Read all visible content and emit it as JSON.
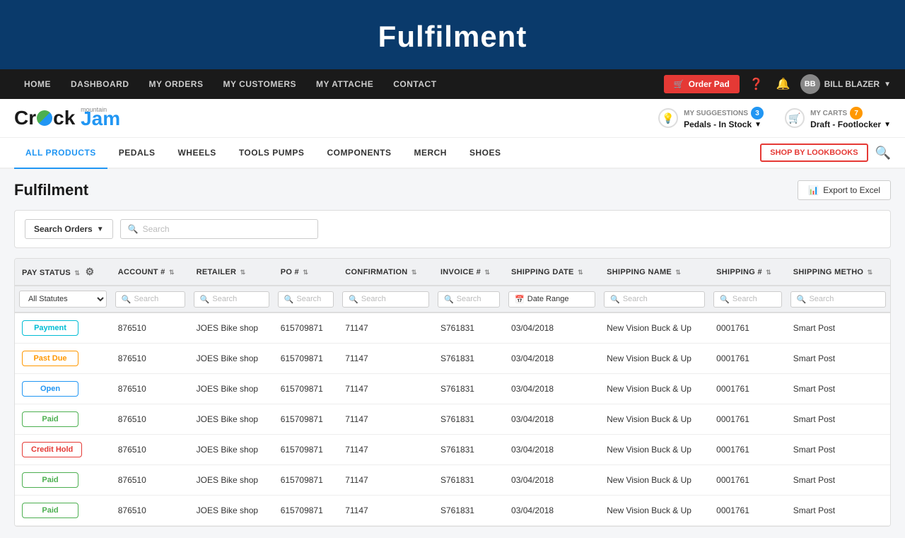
{
  "hero": {
    "title": "Fulfilment"
  },
  "topNav": {
    "items": [
      {
        "label": "HOME",
        "id": "home"
      },
      {
        "label": "DASHBOARD",
        "id": "dashboard"
      },
      {
        "label": "MY ORDERS",
        "id": "my-orders"
      },
      {
        "label": "MY CUSTOMERS",
        "id": "my-customers"
      },
      {
        "label": "MY ATTACHE",
        "id": "my-attache"
      },
      {
        "label": "CONTACT",
        "id": "contact"
      }
    ],
    "orderPadLabel": "Order Pad",
    "userName": "BILL BLAZER",
    "helpIcon": "?",
    "bellIcon": "🔔"
  },
  "brandBar": {
    "logoText1": "Cr",
    "logoText2": "k",
    "logoText3": "Jam",
    "logoSub": "mountain",
    "suggestions": {
      "label": "MY SUGGESTIONS",
      "badge": "3",
      "value": "Pedals - In Stock"
    },
    "carts": {
      "label": "MY CARTS",
      "badge": "7",
      "value": "Draft - Footlocker"
    }
  },
  "catNav": {
    "items": [
      {
        "label": "ALL PRODUCTS",
        "active": true
      },
      {
        "label": "PEDALS"
      },
      {
        "label": "WHEELS"
      },
      {
        "label": "TOOLS PUMPS"
      },
      {
        "label": "COMPONENTS"
      },
      {
        "label": "MERCH"
      },
      {
        "label": "SHOES"
      }
    ],
    "lookbookLabel": "SHOP BY LOOKBOOKS"
  },
  "page": {
    "title": "Fulfilment",
    "exportLabel": "Export to Excel"
  },
  "filters": {
    "searchOrdersLabel": "Search Orders",
    "searchPlaceholder": "Search"
  },
  "table": {
    "columns": [
      {
        "label": "PAY STATUS",
        "id": "pay-status",
        "sortable": true
      },
      {
        "label": "ACCOUNT #",
        "id": "account",
        "sortable": true
      },
      {
        "label": "RETAILER",
        "id": "retailer",
        "sortable": true
      },
      {
        "label": "PO #",
        "id": "po",
        "sortable": true
      },
      {
        "label": "CONFIRMATION",
        "id": "confirmation",
        "sortable": true
      },
      {
        "label": "INVOICE #",
        "id": "invoice",
        "sortable": true
      },
      {
        "label": "SHIPPING DATE",
        "id": "shipping-date",
        "sortable": true
      },
      {
        "label": "SHIPPING NAME",
        "id": "shipping-name",
        "sortable": true
      },
      {
        "label": "SHIPPING #",
        "id": "shipping-num",
        "sortable": true
      },
      {
        "label": "SHIPPING METHO",
        "id": "shipping-method",
        "sortable": true
      }
    ],
    "filterRow": {
      "statusFilterLabel": "All Statutes",
      "searchPlaceholders": [
        "Search",
        "Search",
        "Search",
        "Search",
        "Search",
        "Date Range",
        "Search",
        "Search",
        "Search"
      ]
    },
    "rows": [
      {
        "status": "Payment",
        "statusType": "payment",
        "account": "876510",
        "retailer": "JOES Bike shop",
        "po": "615709871",
        "confirmation": "71147",
        "invoice": "S761831",
        "shippingDate": "03/04/2018",
        "shippingName": "New Vision Buck & Up",
        "shippingNum": "0001761",
        "shippingMethod": "Smart Post"
      },
      {
        "status": "Past Due",
        "statusType": "pastdue",
        "account": "876510",
        "retailer": "JOES Bike shop",
        "po": "615709871",
        "confirmation": "71147",
        "invoice": "S761831",
        "shippingDate": "03/04/2018",
        "shippingName": "New Vision Buck & Up",
        "shippingNum": "0001761",
        "shippingMethod": "Smart Post"
      },
      {
        "status": "Open",
        "statusType": "open",
        "account": "876510",
        "retailer": "JOES Bike shop",
        "po": "615709871",
        "confirmation": "71147",
        "invoice": "S761831",
        "shippingDate": "03/04/2018",
        "shippingName": "New Vision Buck & Up",
        "shippingNum": "0001761",
        "shippingMethod": "Smart Post"
      },
      {
        "status": "Paid",
        "statusType": "paid",
        "account": "876510",
        "retailer": "JOES Bike shop",
        "po": "615709871",
        "confirmation": "71147",
        "invoice": "S761831",
        "shippingDate": "03/04/2018",
        "shippingName": "New Vision Buck & Up",
        "shippingNum": "0001761",
        "shippingMethod": "Smart Post"
      },
      {
        "status": "Credit Hold",
        "statusType": "credithold",
        "account": "876510",
        "retailer": "JOES Bike shop",
        "po": "615709871",
        "confirmation": "71147",
        "invoice": "S761831",
        "shippingDate": "03/04/2018",
        "shippingName": "New Vision Buck & Up",
        "shippingNum": "0001761",
        "shippingMethod": "Smart Post"
      },
      {
        "status": "Paid",
        "statusType": "paid",
        "account": "876510",
        "retailer": "JOES Bike shop",
        "po": "615709871",
        "confirmation": "71147",
        "invoice": "S761831",
        "shippingDate": "03/04/2018",
        "shippingName": "New Vision Buck & Up",
        "shippingNum": "0001761",
        "shippingMethod": "Smart Post"
      },
      {
        "status": "Paid",
        "statusType": "paid",
        "account": "876510",
        "retailer": "JOES Bike shop",
        "po": "615709871",
        "confirmation": "71147",
        "invoice": "S761831",
        "shippingDate": "03/04/2018",
        "shippingName": "New Vision Buck & Up",
        "shippingNum": "0001761",
        "shippingMethod": "Smart Post"
      }
    ]
  },
  "colors": {
    "accent": "#2196f3",
    "danger": "#e53935",
    "navBg": "#1a1a1a",
    "heroBg": "#0a3a6b"
  }
}
